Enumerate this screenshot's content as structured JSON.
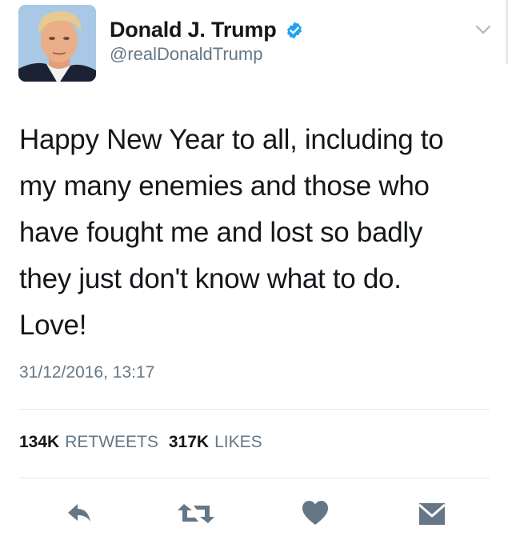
{
  "user": {
    "display_name": "Donald J. Trump",
    "handle": "@realDonaldTrump",
    "verified": true
  },
  "tweet": {
    "text": "Happy New Year to all, including to\nmy many enemies and those who\nhave fought me and lost so badly\nthey just don't know what to do.\nLove!",
    "timestamp": "31/12/2016, 13:17"
  },
  "stats": {
    "retweets_count": "134K",
    "retweets_label": "RETWEETS",
    "likes_count": "317K",
    "likes_label": "LIKES"
  },
  "actions": [
    {
      "icon": "reply-icon"
    },
    {
      "icon": "retweet-icon"
    },
    {
      "icon": "like-heart-icon"
    },
    {
      "icon": "direct-message-icon"
    }
  ],
  "colors": {
    "verified_blue": "#1da1f2",
    "secondary_text": "#657786",
    "primary_text": "#14171a",
    "icon_gray": "#657786",
    "divider": "#e1e8ed"
  }
}
